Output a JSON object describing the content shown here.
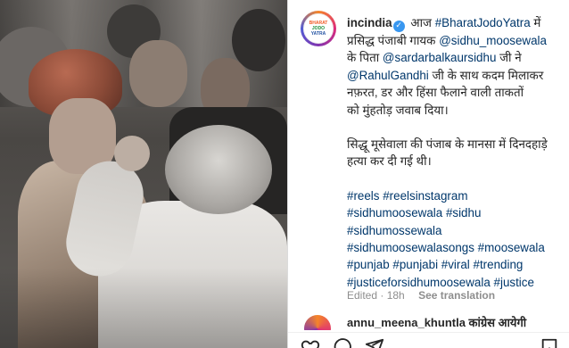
{
  "post": {
    "username": "incindia",
    "avatar_lines": [
      "BHARAT",
      "JODO",
      "YATRA"
    ],
    "caption": {
      "line1_prefix": "आज ",
      "hashtag_yatra": "#BharatJodoYatra",
      "line1_suffix": " में",
      "line2_prefix": "प्रसिद्ध पंजाबी गायक ",
      "mention_sidhu": "@sidhu_moosewala",
      "line3_prefix": "के पिता ",
      "mention_father": "@sardarbalkaursidhu",
      "line3_suffix": " जी ने",
      "mention_rahul": "@RahulGandhi",
      "line4_suffix": " जी के साथ कदम मिलाकर",
      "line5": "नफ़रत, डर और हिंसा फैलाने वाली ताकतों",
      "line6": "को मुंहतोड़ जवाब दिया।",
      "para2": "सिद्धू मूसेवाला की पंजाब के मानसा में दिनदहाड़े हत्या कर दी गई थी।"
    },
    "hashtags": [
      [
        "#reels",
        "#reelsinstagram"
      ],
      [
        "#sidhumoosewala",
        "#sidhu"
      ],
      [
        "#sidhumossewala"
      ],
      [
        "#sidhumoosewalasongs",
        "#moosewala"
      ],
      [
        "#punjab",
        "#punjabi",
        "#viral",
        "#trending"
      ],
      [
        "#justiceforsidhumoosewala",
        "#justice"
      ]
    ],
    "meta": {
      "edited": "Edited · 18h",
      "see_translation": "See translation"
    }
  },
  "comment": {
    "text": "annu_meena_khuntla कांग्रेस आयेगी"
  },
  "icons": {
    "verified": "verified-badge-icon",
    "like": "heart-icon",
    "comment": "comment-icon",
    "share": "share-icon",
    "save": "bookmark-icon"
  },
  "colors": {
    "link": "#00376b",
    "verified": "#3897f0",
    "meta": "#8e8e8e"
  }
}
